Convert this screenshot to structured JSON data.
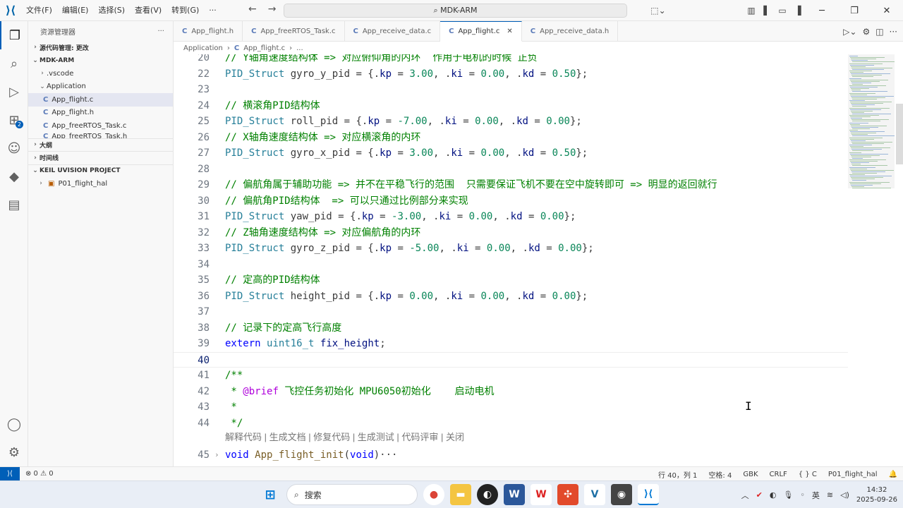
{
  "menu": [
    "文件(F)",
    "编辑(E)",
    "选择(S)",
    "查看(V)",
    "转到(G)",
    "···"
  ],
  "command_center": "MDK-ARM",
  "sidebar": {
    "title": "资源管理器",
    "more": "···",
    "scm": "源代码管理: 更改",
    "root": "MDK-ARM",
    "vscode": ".vscode",
    "application": "Application",
    "files": [
      "App_flight.c",
      "App_flight.h",
      "App_freeRTOS_Task.c"
    ],
    "partial_file": "App_freeRTOS_Task.h",
    "outline": "大纲",
    "timeline": "时间线",
    "keil": "KEIL UVISION PROJECT",
    "project": "P01_flight_hal"
  },
  "tabs": [
    {
      "label": "App_flight.h",
      "active": false
    },
    {
      "label": "App_freeRTOS_Task.c",
      "active": false
    },
    {
      "label": "App_receive_data.c",
      "active": false
    },
    {
      "label": "App_flight.c",
      "active": true
    },
    {
      "label": "App_receive_data.h",
      "active": false
    }
  ],
  "breadcrumb": {
    "folder": "Application",
    "file": "App_flight.c",
    "rest": "..."
  },
  "code": [
    {
      "no": "20",
      "text": "// Y轴角速度结构体 => 对应俯仰角的内环  作用于电机的时候 正负"
    },
    {
      "no": "22",
      "text": "PID_Struct gyro_y_pid = {.kp = 3.00, .ki = 0.00, .kd = 0.50};"
    },
    {
      "no": "23",
      "text": ""
    },
    {
      "no": "24",
      "text": "// 横滚角PID结构体"
    },
    {
      "no": "25",
      "text": "PID_Struct roll_pid = {.kp = -7.00, .ki = 0.00, .kd = 0.00};"
    },
    {
      "no": "26",
      "text": "// X轴角速度结构体 => 对应横滚角的内环"
    },
    {
      "no": "27",
      "text": "PID_Struct gyro_x_pid = {.kp = 3.00, .ki = 0.00, .kd = 0.50};"
    },
    {
      "no": "28",
      "text": ""
    },
    {
      "no": "29",
      "text": "// 偏航角属于辅助功能 => 并不在平稳飞行的范围  只需要保证飞机不要在空中旋转即可 => 明显的返回就行"
    },
    {
      "no": "30",
      "text": "// 偏航角PID结构体  => 可以只通过比例部分来实现"
    },
    {
      "no": "31",
      "text": "PID_Struct yaw_pid = {.kp = -3.00, .ki = 0.00, .kd = 0.00};"
    },
    {
      "no": "32",
      "text": "// Z轴角速度结构体 => 对应偏航角的内环"
    },
    {
      "no": "33",
      "text": "PID_Struct gyro_z_pid = {.kp = -5.00, .ki = 0.00, .kd = 0.00};"
    },
    {
      "no": "34",
      "text": ""
    },
    {
      "no": "35",
      "text": "// 定高的PID结构体"
    },
    {
      "no": "36",
      "text": "PID_Struct height_pid = {.kp = 0.00, .ki = 0.00, .kd = 0.00};"
    },
    {
      "no": "37",
      "text": ""
    },
    {
      "no": "38",
      "text": "// 记录下的定高飞行高度"
    },
    {
      "no": "39",
      "text": "extern uint16_t fix_height;"
    },
    {
      "no": "40",
      "text": ""
    },
    {
      "no": "41",
      "text": "/**"
    },
    {
      "no": "42",
      "text": " * @brief 飞控任务初始化 MPU6050初始化    启动电机"
    },
    {
      "no": "43",
      "text": " *"
    },
    {
      "no": "44",
      "text": " */"
    },
    {
      "no": "45",
      "text": "void App_flight_init(void)···"
    }
  ],
  "codelens": "解释代码 | 生成文档 | 修复代码 | 生成测试 | 代码评审 | 关闭",
  "status": {
    "problems": "⊗ 0 ⚠ 0",
    "position": "行 40，列 1",
    "spaces": "空格: 4",
    "encoding": "GBK",
    "eol": "CRLF",
    "language": "{ } C",
    "project": "P01_flight_hal"
  },
  "taskbar": {
    "search": "搜索",
    "time": "14:32",
    "date": "2025-09-26"
  },
  "colors": {
    "accent": "#005fb8",
    "comment": "#008000",
    "keyword": "#0000ff",
    "type": "#267f99",
    "number": "#098658"
  }
}
